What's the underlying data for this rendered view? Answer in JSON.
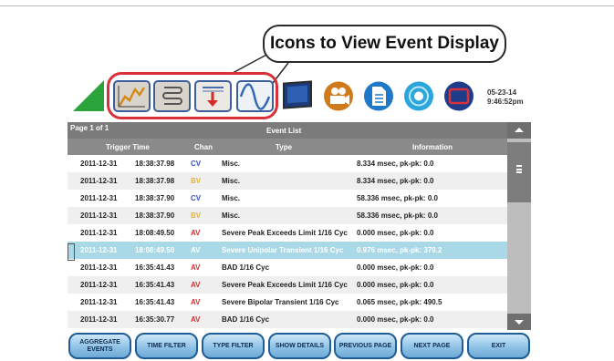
{
  "callout": {
    "text": "Icons to View Event Display"
  },
  "status": {
    "date": "05-23-14",
    "time": "9:46:52pm"
  },
  "list": {
    "page": "Page 1 of 1",
    "title": "Event List",
    "columns": [
      "Trigger Time",
      "Chan",
      "Type",
      "Information"
    ],
    "rows": [
      {
        "date": "2011-12-31",
        "time": "18:38:37.98",
        "chan": "CV",
        "chan_color": "#3a52b8",
        "type": "Misc.",
        "info": "8.334 msec, pk-pk: 0.0"
      },
      {
        "date": "2011-12-31",
        "time": "18:38:37.98",
        "chan": "BV",
        "chan_color": "#e2b43a",
        "type": "Misc.",
        "info": "8.334 msec, pk-pk: 0.0"
      },
      {
        "date": "2011-12-31",
        "time": "18:38:37.90",
        "chan": "CV",
        "chan_color": "#3a52b8",
        "type": "Misc.",
        "info": "58.336 msec, pk-pk: 0.0"
      },
      {
        "date": "2011-12-31",
        "time": "18:38:37.90",
        "chan": "BV",
        "chan_color": "#e2b43a",
        "type": "Misc.",
        "info": "58.336 msec, pk-pk: 0.0"
      },
      {
        "date": "2011-12-31",
        "time": "18:08:49.50",
        "chan": "AV",
        "chan_color": "#d62f2f",
        "type": "Severe Peak Exceeds Limit 1/16 Cyc",
        "info": "0.000 msec, pk-pk: 0.0"
      },
      {
        "date": "2011-12-31",
        "time": "18:08:49.50",
        "chan": "AV",
        "chan_color": "#ffffff",
        "type": "Severe Unipolar Transient 1/16 Cyc",
        "info": "0.976 msec, pk-pk: 379.2"
      },
      {
        "date": "2011-12-31",
        "time": "16:35:41.43",
        "chan": "AV",
        "chan_color": "#d62f2f",
        "type": "BAD 1/16 Cyc",
        "info": "0.000 msec, pk-pk: 0.0"
      },
      {
        "date": "2011-12-31",
        "time": "16:35:41.43",
        "chan": "AV",
        "chan_color": "#d62f2f",
        "type": "Severe Peak Exceeds Limit 1/16 Cyc",
        "info": "0.000 msec, pk-pk: 0.0"
      },
      {
        "date": "2011-12-31",
        "time": "16:35:41.43",
        "chan": "AV",
        "chan_color": "#d62f2f",
        "type": "Severe Bipolar Transient 1/16 Cyc",
        "info": "0.065 msec, pk-pk: 490.5"
      },
      {
        "date": "2011-12-31",
        "time": "16:35:30.77",
        "chan": "AV",
        "chan_color": "#d62f2f",
        "type": "BAD 1/16 Cyc",
        "info": "0.000 msec, pk-pk: 0.0"
      }
    ]
  },
  "buttons": {
    "aggregate": "AGGREGATE EVENTS",
    "time_filter": "TIME FILTER",
    "type_filter": "TYPE FILTER",
    "show_details": "SHOW DETAILS",
    "previous_page": "PREVIOUS PAGE",
    "next_page": "NEXT PAGE",
    "exit": "EXIT"
  },
  "colors": {
    "accent_ring": "#d9303a",
    "header": "#7b7b7b",
    "selected_row": "#a9d8e7",
    "button_border": "#1f5d96"
  },
  "icons": [
    "status-triangle-icon",
    "graph-view-icon",
    "report-view-icon",
    "import-export-icon",
    "waveform-view-icon",
    "monitor-icon",
    "video-icon",
    "document-icon",
    "wireless-icon",
    "screen-icon"
  ]
}
